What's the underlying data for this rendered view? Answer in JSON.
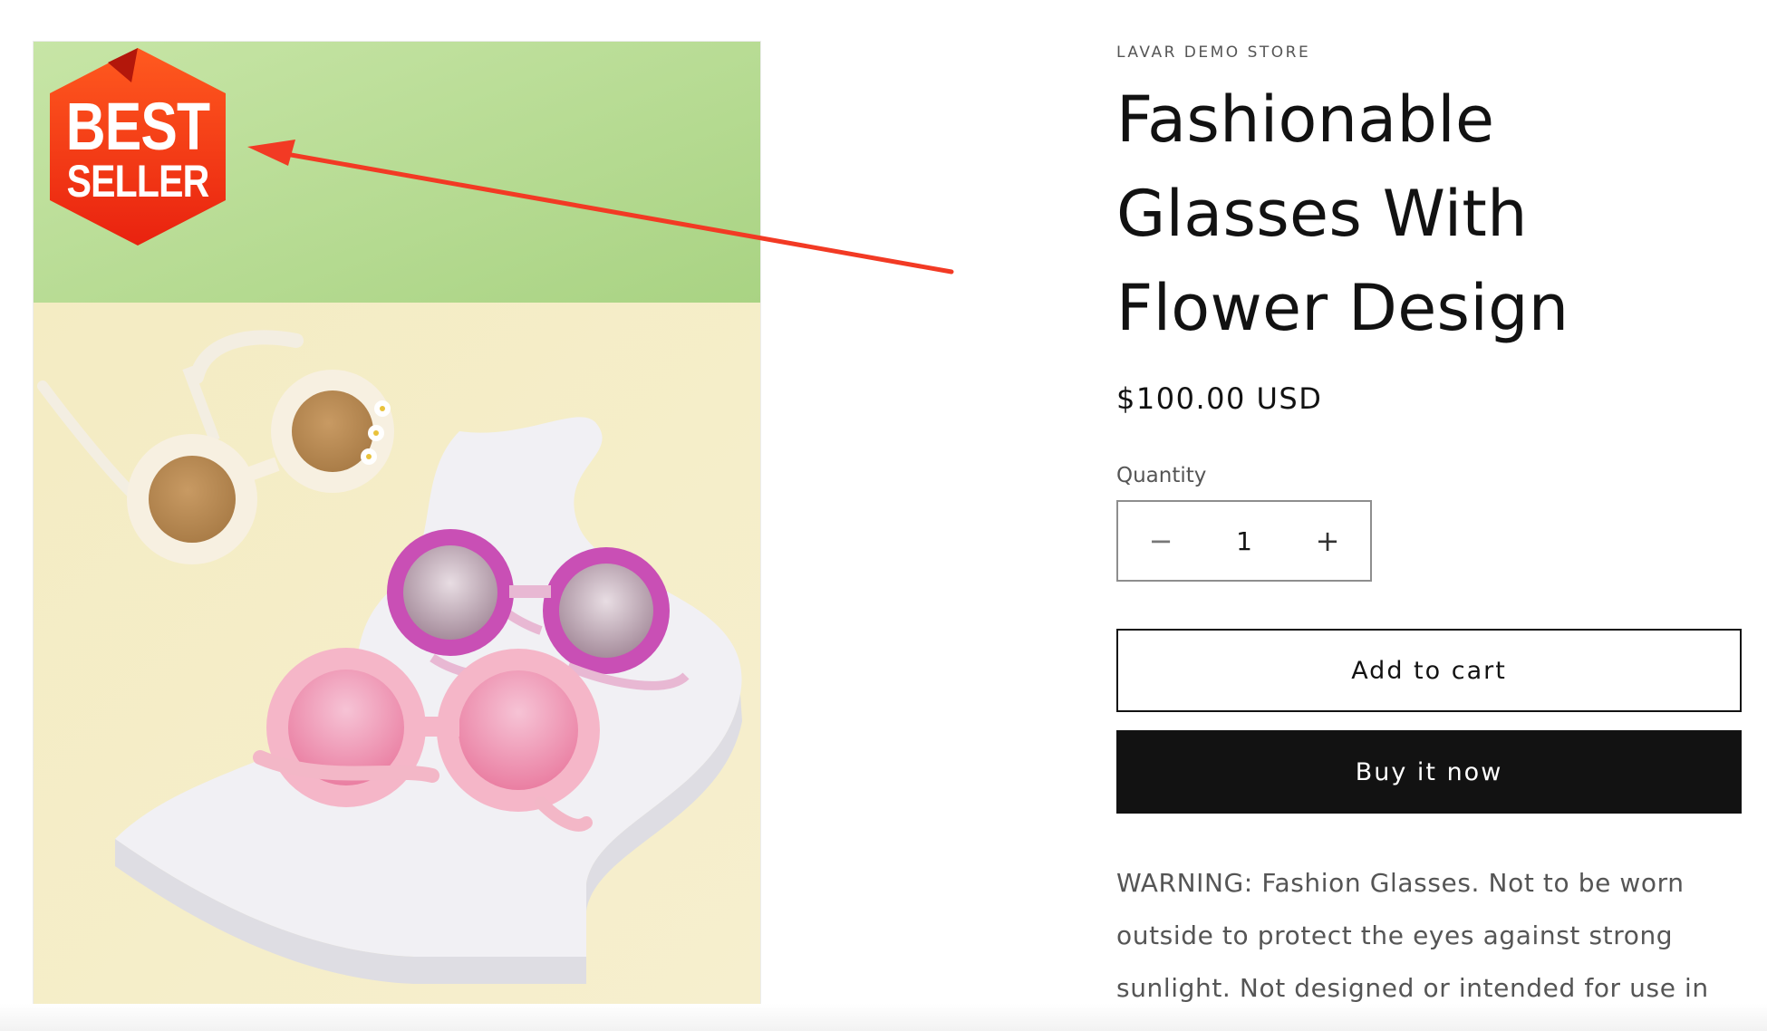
{
  "product": {
    "vendor": "LAVAR DEMO STORE",
    "title": "Fashionable Glasses With Flower Design",
    "price": "$100.00 USD",
    "quantity_label": "Quantity",
    "quantity_value": "1",
    "decrease_symbol": "−",
    "increase_symbol": "+",
    "add_to_cart_label": "Add to cart",
    "buy_now_label": "Buy it now",
    "description": "WARNING: Fashion Glasses. Not to be worn outside to protect the eyes against strong sunlight. Not designed or intended for use in play by children."
  },
  "media": {
    "badge_line1": "BEST",
    "badge_line2": "SELLER",
    "badge_color": "#f0401a",
    "annotation_arrow_color": "#f23a24",
    "background_top_color": "#b4d98a",
    "background_bottom_color": "#f3ecc6"
  },
  "colors": {
    "button_dark": "#121212",
    "text_muted": "#555555"
  }
}
